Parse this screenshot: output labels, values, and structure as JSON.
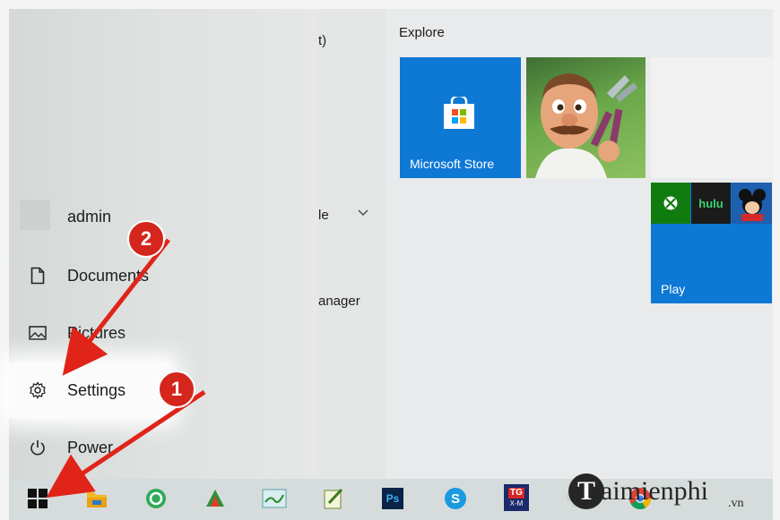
{
  "left_panel": {
    "user_name": "admin",
    "items": [
      {
        "label": "Documents",
        "icon": "document-icon"
      },
      {
        "label": "Pictures",
        "icon": "pictures-icon"
      },
      {
        "label": "Settings",
        "icon": "gear-icon"
      },
      {
        "label": "Power",
        "icon": "power-icon"
      }
    ]
  },
  "middle_fragments": {
    "frag1": "t)",
    "frag2": "le",
    "frag3": "anager"
  },
  "tiles": {
    "group_title": "Explore",
    "store_label": "Microsoft Store",
    "play_label": "Play",
    "hulu_text": "hulu"
  },
  "annotations": {
    "badge1": "1",
    "badge2": "2"
  },
  "taskbar": {
    "photoshop_label": "Ps",
    "tg_label_top": "TG",
    "tg_label_bottom": "X-M",
    "icons": [
      "windows-start-icon",
      "file-explorer-icon",
      "app-green-icon",
      "app-paint-icon",
      "app-map-icon",
      "app-notepad-icon",
      "photoshop-icon",
      "skype-icon",
      "tg-app-icon",
      "app-generic-icon",
      "chrome-icon"
    ]
  },
  "watermark": {
    "logo_letter": "T",
    "brand": "aimienphi",
    "tld": ".vn"
  },
  "colors": {
    "tile_blue": "#0e78d5",
    "xbox_green": "#107c10",
    "badge_red": "#d4261c",
    "arrow_red": "#e0241a"
  }
}
